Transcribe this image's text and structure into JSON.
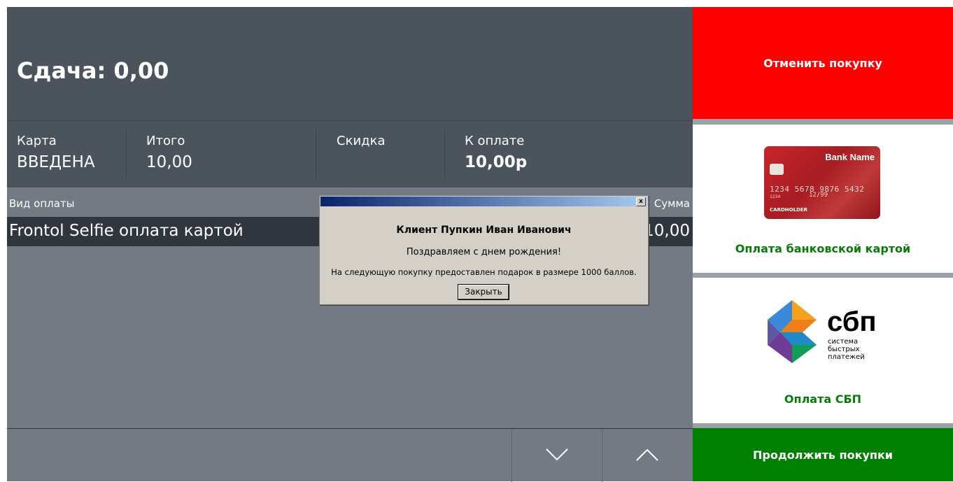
{
  "change": {
    "label": "Сдача: 0,00"
  },
  "totals": {
    "card": {
      "caption": "Карта",
      "value": "ВВЕДЕНА"
    },
    "total": {
      "caption": "Итого",
      "value": "10,00"
    },
    "discount": {
      "caption": "Скидка",
      "value": ""
    },
    "to_pay": {
      "caption": "К оплате",
      "value": "10,00р"
    }
  },
  "payments_table": {
    "columns": [
      "Вид оплаты",
      "Сумма"
    ],
    "rows": [
      {
        "type": "Frontol Selfie оплата картой",
        "amount": "10,00"
      }
    ]
  },
  "navigation": {
    "down_icon": "chevron-down-icon",
    "up_icon": "chevron-up-icon"
  },
  "actions": {
    "cancel_label": "Отменить покупку",
    "card_payment_label": "Оплата банковской картой",
    "sbp_payment_label": "Оплата СБП",
    "continue_label": "Продолжить покупки"
  },
  "bank_card": {
    "bank_name": "Bank Name",
    "number": "1234 5678 9876 5432",
    "small_number": "1234",
    "expiry": "12/99",
    "holder": "CARDHOLDER"
  },
  "sbp_logo": {
    "title": "сбп",
    "subtitle": "система быстрых платежей"
  },
  "dialog": {
    "title": "Клиент Пупкин Иван Иванович",
    "greeting": "Поздравляем с днем рождения!",
    "message": "На следующую покупку предоставлен подарок в размере 1000 баллов.",
    "button": "Закрыть",
    "close_glyph": "x"
  },
  "colors": {
    "header_bg": "#4b545d",
    "table_bg": "#747a83",
    "selected_row_bg": "#2f363d",
    "cancel_bg": "#ff0000",
    "continue_bg": "#008000",
    "pay_label_color": "#0a7a0a"
  }
}
